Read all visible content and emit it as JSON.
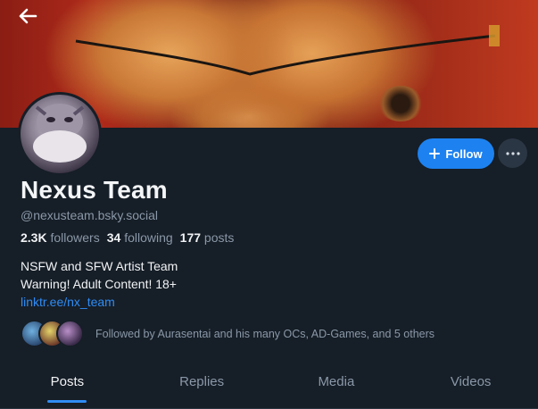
{
  "header": {
    "back_icon": "arrow-left-icon"
  },
  "profile": {
    "display_name": "Nexus Team",
    "handle": "@nexusteam.bsky.social",
    "stats": {
      "followers_count": "2.3K",
      "followers_label": "followers",
      "following_count": "34",
      "following_label": "following",
      "posts_count": "177",
      "posts_label": "posts"
    },
    "bio": {
      "line1": "NSFW and SFW Artist Team",
      "line2": "Warning! Adult Content! 18+",
      "link": "linktr.ee/nx_team"
    },
    "followed_by": "Followed by Aurasentai and his many OCs, AD-Games, and 5 others"
  },
  "actions": {
    "follow_label": "Follow",
    "follow_icon": "plus-icon",
    "more_icon": "ellipsis-icon",
    "accent": "#1d82f0"
  },
  "tabs": [
    {
      "label": "Posts",
      "active": true
    },
    {
      "label": "Replies",
      "active": false
    },
    {
      "label": "Media",
      "active": false
    },
    {
      "label": "Videos",
      "active": false
    }
  ]
}
